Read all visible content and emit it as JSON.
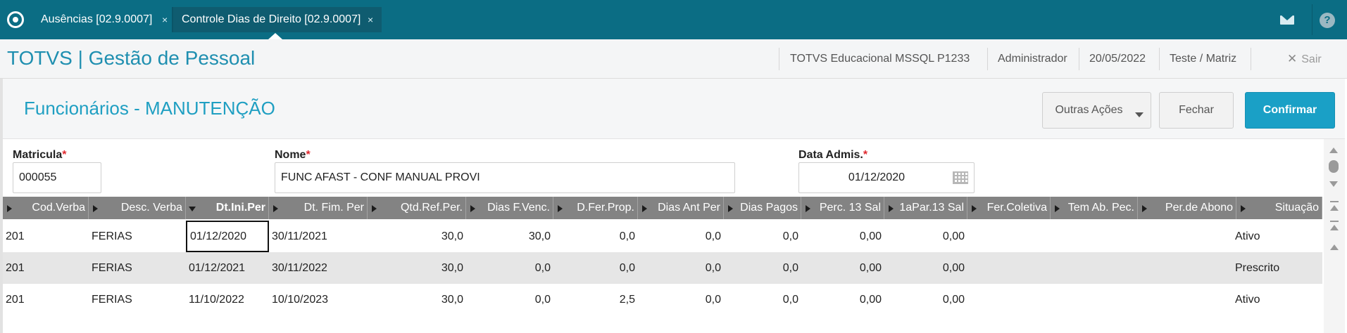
{
  "tabs": [
    {
      "label": "Ausências [02.9.0007]",
      "close": "×"
    },
    {
      "label": "Controle Dias de Direito [02.9.0007]",
      "close": "×"
    }
  ],
  "header": {
    "brand": "TOTVS | Gestão de Pessoal",
    "environment": "TOTVS Educacional MSSQL P1233",
    "user": "Administrador",
    "date": "20/05/2022",
    "branch": "Teste / Matriz",
    "exit_label": "Sair",
    "exit_icon": "✕"
  },
  "page": {
    "title": "Funcionários - MANUTENÇÃO",
    "buttons": {
      "more": "Outras Ações",
      "close": "Fechar",
      "confirm": "Confirmar"
    }
  },
  "form": {
    "matricula": {
      "label": "Matricula",
      "value": "000055"
    },
    "nome": {
      "label": "Nome",
      "value": "FUNC AFAST - CONF MANUAL PROVI"
    },
    "data_admis": {
      "label": "Data Admis.",
      "value": "01/12/2020"
    },
    "required_mark": "*"
  },
  "grid": {
    "columns": [
      "Cod.Verba",
      "Desc. Verba",
      "Dt.Ini.Per",
      "Dt. Fim. Per",
      "Qtd.Ref.Per.",
      "Dias F.Venc.",
      "D.Fer.Prop.",
      "Dias Ant Per",
      "Dias Pagos",
      "Perc. 13 Sal",
      "1aPar.13 Sal",
      "Fer.Coletiva",
      "Tem Ab. Pec.",
      "Per.de Abono",
      "Situação"
    ],
    "rows": [
      [
        "201",
        "FERIAS",
        "01/12/2020",
        "30/11/2021",
        "30,0",
        "30,0",
        "0,0",
        "0,0",
        "0,0",
        "0,00",
        "0,00",
        "",
        "",
        "",
        "Ativo"
      ],
      [
        "201",
        "FERIAS",
        "01/12/2021",
        "30/11/2022",
        "30,0",
        "0,0",
        "0,0",
        "0,0",
        "0,0",
        "0,00",
        "0,00",
        "",
        "",
        "",
        "Prescrito"
      ],
      [
        "201",
        "FERIAS",
        "11/10/2022",
        "10/10/2023",
        "30,0",
        "0,0",
        "2,5",
        "0,0",
        "0,0",
        "0,00",
        "0,00",
        "",
        "",
        "",
        "Ativo"
      ]
    ]
  },
  "colors": {
    "topbar": "#0b6d84",
    "accent": "#1aa0c6",
    "brand": "#1f8fb0",
    "required": "#e0282e",
    "grid_header": "#838383"
  }
}
